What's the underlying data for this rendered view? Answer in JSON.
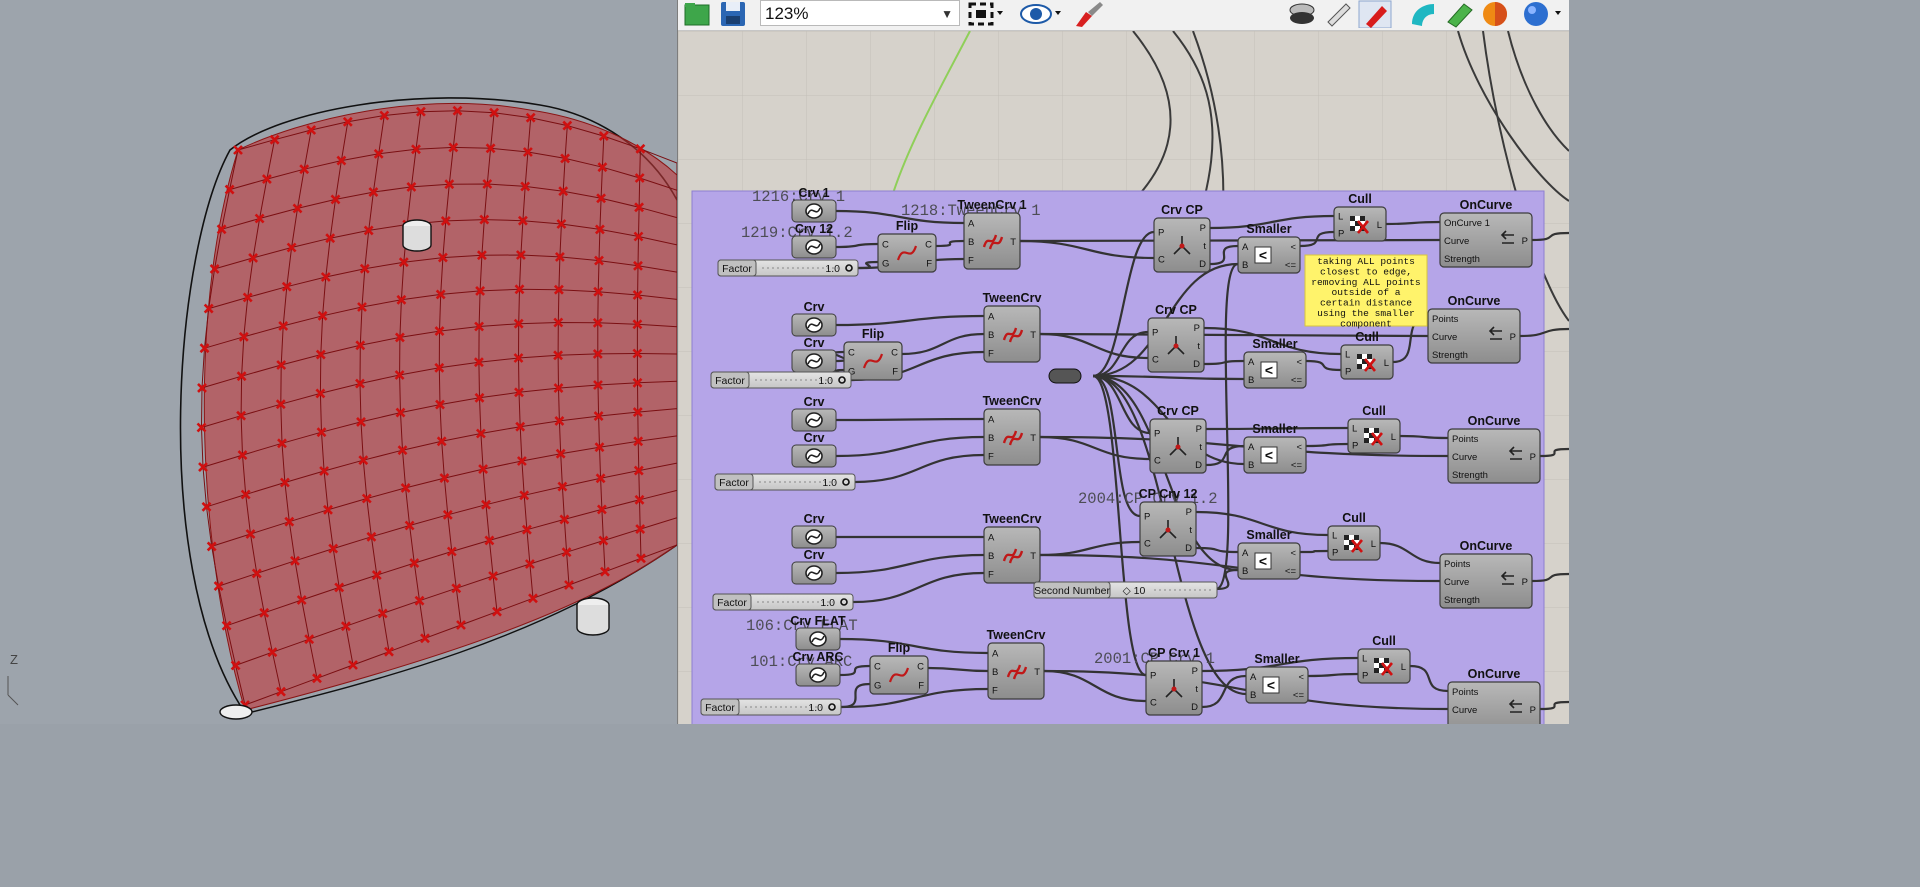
{
  "toolbar": {
    "zoom_value": "123%",
    "icons": [
      "open-file-icon",
      "save-icon",
      "zoom-extents-icon",
      "preview-eye-icon",
      "paint-brush-icon",
      "preview-shaded-icon",
      "preview-wire-icon",
      "preview-selected-icon",
      "cyan-shape-icon",
      "green-shape-icon",
      "orange-sphere-icon",
      "blue-sphere-icon"
    ]
  },
  "viewport": {
    "axis_label": "Z",
    "colors": {
      "surface": "#c0393b",
      "points": "#d01010",
      "background": "#9da4ac"
    }
  },
  "group": {
    "color": "#b5a5e8"
  },
  "rows": [
    {
      "crv_a": "Crv 1",
      "crv_b": "Crv 12",
      "flip": "Flip",
      "factor_label": "Factor",
      "factor_value": "1.0",
      "tween": "TweenCrv 1",
      "crvcp": "Crv CP",
      "smaller": "Smaller",
      "cull": "Cull",
      "oncurve": "OnCurve",
      "oncurve_in": "OnCurve 1",
      "labels": [
        "1216:Crv 1",
        "1219:Crv 1.2",
        "1218:TweenCrv 1"
      ]
    },
    {
      "crv_a": "Crv",
      "crv_b": "Crv",
      "flip": "Flip",
      "factor_label": "Factor",
      "factor_value": "1.0",
      "tween": "TweenCrv",
      "crvcp": "Crv CP",
      "smaller": "Smaller",
      "cull": "Cull",
      "oncurve": "OnCurve",
      "oncurve_in": "Points"
    },
    {
      "crv_a": "Crv",
      "crv_b": "Crv",
      "factor_label": "Factor",
      "factor_value": "1.0",
      "tween": "TweenCrv",
      "crvcp": "Crv CP",
      "smaller": "Smaller",
      "cull": "Cull",
      "oncurve": "OnCurve",
      "oncurve_in": "Points"
    },
    {
      "crv_a": "Crv",
      "crv_b": "Crv",
      "factor_label": "Factor",
      "factor_value": "1.0",
      "tween": "TweenCrv",
      "crvcp": "CP Crv 12",
      "smaller": "Smaller",
      "cull": "Cull",
      "oncurve": "OnCurve",
      "oncurve_in": "Points",
      "labels": [
        "2004:CP Crv 1.2"
      ]
    },
    {
      "crv_a": "Crv FLAT",
      "crv_b": "Crv ARC",
      "flip": "Flip",
      "factor_label": "Factor",
      "factor_value": "1.0",
      "tween": "TweenCrv",
      "crvcp": "CP Crv 1",
      "smaller": "Smaller",
      "cull": "Cull",
      "oncurve": "OnCurve",
      "oncurve_in": "Points",
      "labels": [
        "106:Crv FLAT",
        "101:Crv ARC",
        "2001:CP Crv 1"
      ]
    }
  ],
  "second_number": {
    "label": "Second Number",
    "value": "10"
  },
  "panel_note": "taking ALL points closest to edge, removing ALL points outside of a certain distance using the smaller component",
  "ports": {
    "tween_in": [
      "A",
      "B",
      "F"
    ],
    "tween_out": "T",
    "crvcp_in": [
      "P",
      "C"
    ],
    "crvcp_out": [
      "P",
      "t",
      "D"
    ],
    "smaller_in": [
      "A",
      "B"
    ],
    "smaller_out": [
      "<",
      "<="
    ],
    "cull_in": [
      "L",
      "P"
    ],
    "cull_out": "L",
    "flip_in": [
      "C",
      "G"
    ],
    "flip_out": [
      "C",
      "F"
    ],
    "oncurve_in": [
      "Curve",
      "Strength"
    ],
    "oncurve_out": "P"
  }
}
